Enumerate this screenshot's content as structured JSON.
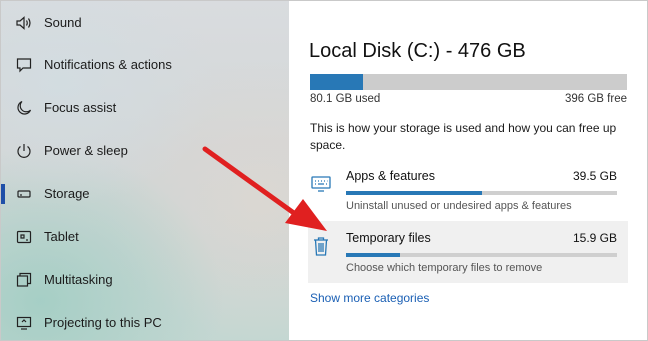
{
  "sidebar": {
    "items": [
      {
        "label": "Sound",
        "icon": "speaker-icon"
      },
      {
        "label": "Notifications & actions",
        "icon": "message-icon"
      },
      {
        "label": "Focus assist",
        "icon": "moon-icon"
      },
      {
        "label": "Power & sleep",
        "icon": "power-icon"
      },
      {
        "label": "Storage",
        "icon": "drive-icon",
        "active": true
      },
      {
        "label": "Tablet",
        "icon": "tablet-icon"
      },
      {
        "label": "Multitasking",
        "icon": "multitask-icon"
      },
      {
        "label": "Projecting to this PC",
        "icon": "projector-icon"
      }
    ]
  },
  "main": {
    "title": "Local Disk (C:) - 476 GB",
    "disk_used_fraction": 0.168,
    "used_text": "80.1 GB used",
    "free_text": "396 GB free",
    "description": "This is how your storage is used and how you can free up space.",
    "categories": [
      {
        "name": "Apps & features",
        "size": "39.5 GB",
        "fill_fraction": 0.5,
        "subtitle": "Uninstall unused or undesired apps & features",
        "icon": "monitor-keyboard-icon"
      },
      {
        "name": "Temporary files",
        "size": "15.9 GB",
        "fill_fraction": 0.2,
        "subtitle": "Choose which temporary files to remove",
        "icon": "trash-icon",
        "highlighted": true
      }
    ],
    "show_more": "Show more categories"
  },
  "colors": {
    "accent": "#2878b6",
    "active_indicator": "#1f4fa8",
    "link": "#1a5fb4",
    "arrow": "#e02020"
  }
}
